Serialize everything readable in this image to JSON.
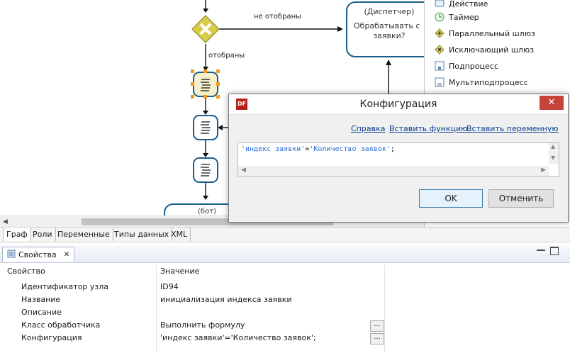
{
  "canvas": {
    "edge_not_selected": "не отобраны",
    "edge_selected": "отобраны",
    "dispatcher_role": "(Диспетчер)",
    "dispatcher_task": "Обрабатывать с",
    "dispatcher_task2": "заявки?",
    "bot_role": "(бот)"
  },
  "palette": {
    "items": [
      {
        "label": "Действие",
        "icon": "action-icon"
      },
      {
        "label": "Таймер",
        "icon": "timer-icon"
      },
      {
        "label": "Параллельный шлюз",
        "icon": "parallel-gateway-icon"
      },
      {
        "label": "Исключающий шлюз",
        "icon": "exclusive-gateway-icon"
      },
      {
        "label": "Подпроцесс",
        "icon": "subprocess-icon"
      },
      {
        "label": "Мультиподпроцесс",
        "icon": "multi-subprocess-icon"
      }
    ]
  },
  "tabs": [
    "Граф",
    "Роли",
    "Переменные",
    "Типы данных",
    "XML"
  ],
  "properties": {
    "tab_label": "Свойства",
    "col_property": "Свойство",
    "col_value": "Значение",
    "rows": [
      {
        "key": "Идентификатор узла",
        "value": "ID94"
      },
      {
        "key": "Название",
        "value": "инициализация индекса заявки"
      },
      {
        "key": "Описание",
        "value": ""
      },
      {
        "key": "Класс обработчика",
        "value": "Выполнить формулу"
      },
      {
        "key": "Конфигурация",
        "value": "'индекс заявки'='Количество заявок';"
      }
    ],
    "dots_label": "..."
  },
  "dialog": {
    "title": "Конфигурация",
    "close": "✕",
    "link_help": "Справка",
    "link_insert_function": "Вставить функцию",
    "link_insert_variable": "Вставить переменную",
    "code_part1": "'индекс заявки'",
    "code_part2": "=",
    "code_part3": "'Количество заявок'",
    "code_part4": ";",
    "ok": "OK",
    "cancel": "Отменить"
  },
  "colors": {
    "accent_node": "#1b5e8c",
    "gateway": "#d8cc4a",
    "dialog_close": "#c7433a",
    "link": "#0b3d91",
    "code_string": "#2a6ad6"
  }
}
